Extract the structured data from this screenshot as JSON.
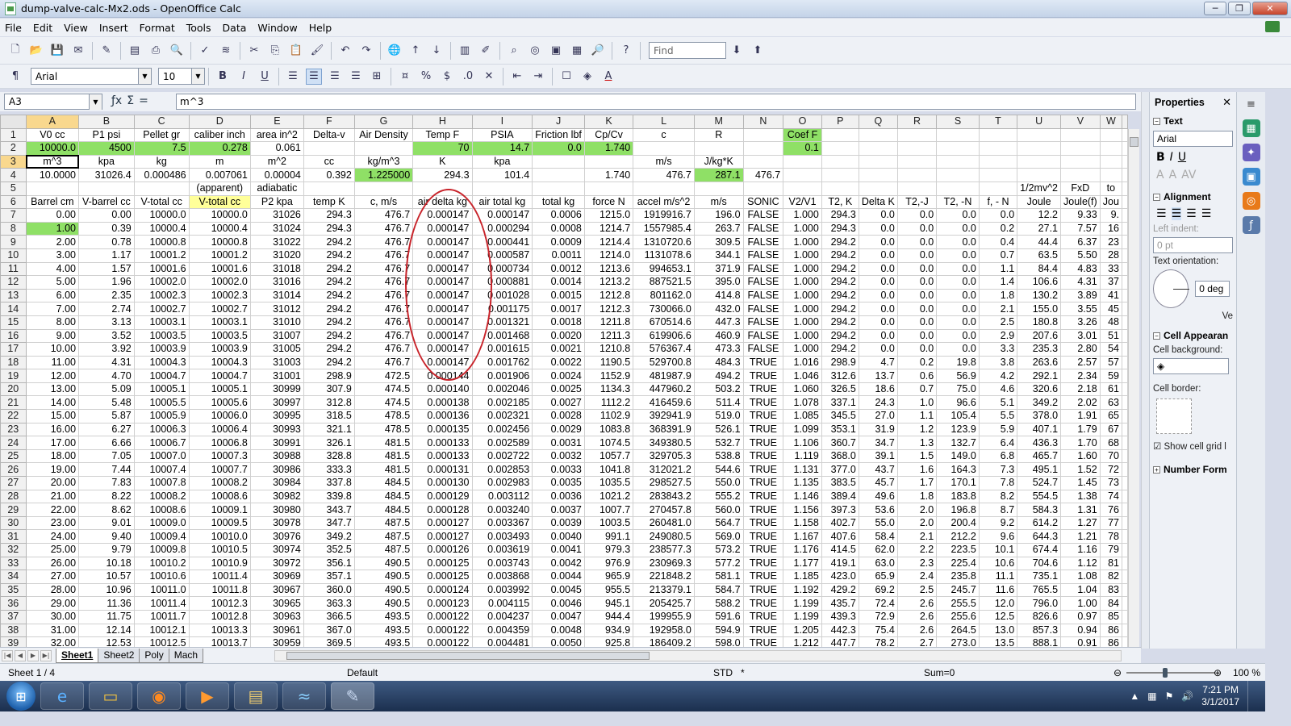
{
  "window": {
    "title": "dump-valve-calc-Mx2.ods - OpenOffice Calc",
    "minimize": "─",
    "maximize": "❐",
    "close": "✕"
  },
  "menu": [
    "File",
    "Edit",
    "View",
    "Insert",
    "Format",
    "Tools",
    "Data",
    "Window",
    "Help"
  ],
  "toolbar": {
    "find_placeholder": "Find",
    "font_name": "Arial",
    "font_size": "10"
  },
  "formula_bar": {
    "cell_ref": "A3",
    "content": "m^3",
    "fx": "ƒx",
    "sum": "Σ",
    "equals": "="
  },
  "sheet": {
    "columns": [
      "A",
      "B",
      "C",
      "D",
      "E",
      "F",
      "G",
      "H",
      "I",
      "J",
      "K",
      "L",
      "M",
      "N",
      "O",
      "P",
      "Q",
      "R",
      "S",
      "T",
      "U",
      "V",
      "W"
    ],
    "rows": [
      [
        "V0 cc",
        "P1 psi",
        "Pellet gr",
        "caliber inch",
        "area in^2",
        "Delta-v",
        "Air Density",
        "Temp F",
        "PSIA",
        "Friction lbf",
        "Cp/Cv",
        "c",
        "R",
        "",
        "Coef F",
        "",
        "",
        "",
        "",
        "",
        "",
        "",
        ""
      ],
      [
        "10000.0",
        "4500",
        "7.5",
        "0.278",
        "0.061",
        "",
        "",
        "70",
        "14.7",
        "0.0",
        "1.740",
        "",
        "",
        "",
        "0.1",
        "",
        "",
        "",
        "",
        "",
        "",
        "",
        ""
      ],
      [
        "m^3",
        "kpa",
        "kg",
        "m",
        "m^2",
        "cc",
        "kg/m^3",
        "K",
        "kpa",
        "",
        "",
        "m/s",
        "J/kg*K",
        "",
        "",
        "",
        "",
        "",
        "",
        "",
        "",
        "",
        ""
      ],
      [
        "10.0000",
        "31026.4",
        "0.000486",
        "0.007061",
        "0.00004",
        "0.392",
        "1.225000",
        "294.3",
        "101.4",
        "",
        "1.740",
        "476.7",
        "287.1",
        "476.7",
        "",
        "",
        "",
        "",
        "",
        "",
        "",
        "",
        ""
      ],
      [
        "",
        "",
        "",
        "(apparent)",
        "adiabatic",
        "",
        "",
        "",
        "",
        "",
        "",
        "",
        "",
        "",
        "",
        "",
        "",
        "",
        "",
        "",
        "1/2mv^2",
        "FxD",
        "to"
      ],
      [
        "Barrel cm",
        "V-barrel cc",
        "V-total cc",
        "V-total cc",
        "P2 kpa",
        "temp K",
        "c, m/s",
        "air delta kg",
        "air total kg",
        "total kg",
        "force N",
        "accel m/s^2",
        "m/s",
        "SONIC",
        "V2/V1",
        "T2, K",
        "Delta K",
        "T2,-J",
        "T2, -N",
        "f, - N",
        "Joule",
        "Joule(f)",
        "Jou"
      ],
      [
        "0.00",
        "0.00",
        "10000.0",
        "10000.0",
        "31026",
        "294.3",
        "476.7",
        "0.000147",
        "0.000147",
        "0.0006",
        "1215.0",
        "1919916.7",
        "196.0",
        "FALSE",
        "1.000",
        "294.3",
        "0.0",
        "0.0",
        "0.0",
        "0.0",
        "12.2",
        "9.33",
        "9."
      ],
      [
        "1.00",
        "0.39",
        "10000.4",
        "10000.4",
        "31024",
        "294.3",
        "476.7",
        "0.000147",
        "0.000294",
        "0.0008",
        "1214.7",
        "1557985.4",
        "263.7",
        "FALSE",
        "1.000",
        "294.3",
        "0.0",
        "0.0",
        "0.0",
        "0.2",
        "27.1",
        "7.57",
        "16"
      ],
      [
        "2.00",
        "0.78",
        "10000.8",
        "10000.8",
        "31022",
        "294.2",
        "476.7",
        "0.000147",
        "0.000441",
        "0.0009",
        "1214.4",
        "1310720.6",
        "309.5",
        "FALSE",
        "1.000",
        "294.2",
        "0.0",
        "0.0",
        "0.0",
        "0.4",
        "44.4",
        "6.37",
        "23"
      ],
      [
        "3.00",
        "1.17",
        "10001.2",
        "10001.2",
        "31020",
        "294.2",
        "476.7",
        "0.000147",
        "0.000587",
        "0.0011",
        "1214.0",
        "1131078.6",
        "344.1",
        "FALSE",
        "1.000",
        "294.2",
        "0.0",
        "0.0",
        "0.0",
        "0.7",
        "63.5",
        "5.50",
        "28"
      ],
      [
        "4.00",
        "1.57",
        "10001.6",
        "10001.6",
        "31018",
        "294.2",
        "476.7",
        "0.000147",
        "0.000734",
        "0.0012",
        "1213.6",
        "994653.1",
        "371.9",
        "FALSE",
        "1.000",
        "294.2",
        "0.0",
        "0.0",
        "0.0",
        "1.1",
        "84.4",
        "4.83",
        "33"
      ],
      [
        "5.00",
        "1.96",
        "10002.0",
        "10002.0",
        "31016",
        "294.2",
        "476.7",
        "0.000147",
        "0.000881",
        "0.0014",
        "1213.2",
        "887521.5",
        "395.0",
        "FALSE",
        "1.000",
        "294.2",
        "0.0",
        "0.0",
        "0.0",
        "1.4",
        "106.6",
        "4.31",
        "37"
      ],
      [
        "6.00",
        "2.35",
        "10002.3",
        "10002.3",
        "31014",
        "294.2",
        "476.7",
        "0.000147",
        "0.001028",
        "0.0015",
        "1212.8",
        "801162.0",
        "414.8",
        "FALSE",
        "1.000",
        "294.2",
        "0.0",
        "0.0",
        "0.0",
        "1.8",
        "130.2",
        "3.89",
        "41"
      ],
      [
        "7.00",
        "2.74",
        "10002.7",
        "10002.7",
        "31012",
        "294.2",
        "476.7",
        "0.000147",
        "0.001175",
        "0.0017",
        "1212.3",
        "730066.0",
        "432.0",
        "FALSE",
        "1.000",
        "294.2",
        "0.0",
        "0.0",
        "0.0",
        "2.1",
        "155.0",
        "3.55",
        "45"
      ],
      [
        "8.00",
        "3.13",
        "10003.1",
        "10003.1",
        "31010",
        "294.2",
        "476.7",
        "0.000147",
        "0.001321",
        "0.0018",
        "1211.8",
        "670514.6",
        "447.3",
        "FALSE",
        "1.000",
        "294.2",
        "0.0",
        "0.0",
        "0.0",
        "2.5",
        "180.8",
        "3.26",
        "48"
      ],
      [
        "9.00",
        "3.52",
        "10003.5",
        "10003.5",
        "31007",
        "294.2",
        "476.7",
        "0.000147",
        "0.001468",
        "0.0020",
        "1211.3",
        "619906.6",
        "460.9",
        "FALSE",
        "1.000",
        "294.2",
        "0.0",
        "0.0",
        "0.0",
        "2.9",
        "207.6",
        "3.01",
        "51"
      ],
      [
        "10.00",
        "3.92",
        "10003.9",
        "10003.9",
        "31005",
        "294.2",
        "476.7",
        "0.000147",
        "0.001615",
        "0.0021",
        "1210.8",
        "576367.4",
        "473.3",
        "FALSE",
        "1.000",
        "294.2",
        "0.0",
        "0.0",
        "0.0",
        "3.3",
        "235.3",
        "2.80",
        "54"
      ],
      [
        "11.00",
        "4.31",
        "10004.3",
        "10004.3",
        "31003",
        "294.2",
        "476.7",
        "0.000147",
        "0.001762",
        "0.0022",
        "1190.5",
        "529700.8",
        "484.3",
        "TRUE",
        "1.016",
        "298.9",
        "4.7",
        "0.2",
        "19.8",
        "3.8",
        "263.6",
        "2.57",
        "57"
      ],
      [
        "12.00",
        "4.70",
        "10004.7",
        "10004.7",
        "31001",
        "298.9",
        "472.5",
        "0.000144",
        "0.001906",
        "0.0024",
        "1152.9",
        "481987.9",
        "494.2",
        "TRUE",
        "1.046",
        "312.6",
        "13.7",
        "0.6",
        "56.9",
        "4.2",
        "292.1",
        "2.34",
        "59"
      ],
      [
        "13.00",
        "5.09",
        "10005.1",
        "10005.1",
        "30999",
        "307.9",
        "474.5",
        "0.000140",
        "0.002046",
        "0.0025",
        "1134.3",
        "447960.2",
        "503.2",
        "TRUE",
        "1.060",
        "326.5",
        "18.6",
        "0.7",
        "75.0",
        "4.6",
        "320.6",
        "2.18",
        "61"
      ],
      [
        "14.00",
        "5.48",
        "10005.5",
        "10005.6",
        "30997",
        "312.8",
        "474.5",
        "0.000138",
        "0.002185",
        "0.0027",
        "1112.2",
        "416459.6",
        "511.4",
        "TRUE",
        "1.078",
        "337.1",
        "24.3",
        "1.0",
        "96.6",
        "5.1",
        "349.2",
        "2.02",
        "63"
      ],
      [
        "15.00",
        "5.87",
        "10005.9",
        "10006.0",
        "30995",
        "318.5",
        "478.5",
        "0.000136",
        "0.002321",
        "0.0028",
        "1102.9",
        "392941.9",
        "519.0",
        "TRUE",
        "1.085",
        "345.5",
        "27.0",
        "1.1",
        "105.4",
        "5.5",
        "378.0",
        "1.91",
        "65"
      ],
      [
        "16.00",
        "6.27",
        "10006.3",
        "10006.4",
        "30993",
        "321.1",
        "478.5",
        "0.000135",
        "0.002456",
        "0.0029",
        "1083.8",
        "368391.9",
        "526.1",
        "TRUE",
        "1.099",
        "353.1",
        "31.9",
        "1.2",
        "123.9",
        "5.9",
        "407.1",
        "1.79",
        "67"
      ],
      [
        "17.00",
        "6.66",
        "10006.7",
        "10006.8",
        "30991",
        "326.1",
        "481.5",
        "0.000133",
        "0.002589",
        "0.0031",
        "1074.5",
        "349380.5",
        "532.7",
        "TRUE",
        "1.106",
        "360.7",
        "34.7",
        "1.3",
        "132.7",
        "6.4",
        "436.3",
        "1.70",
        "68"
      ],
      [
        "18.00",
        "7.05",
        "10007.0",
        "10007.3",
        "30988",
        "328.8",
        "481.5",
        "0.000133",
        "0.002722",
        "0.0032",
        "1057.7",
        "329705.3",
        "538.8",
        "TRUE",
        "1.119",
        "368.0",
        "39.1",
        "1.5",
        "149.0",
        "6.8",
        "465.7",
        "1.60",
        "70"
      ],
      [
        "19.00",
        "7.44",
        "10007.4",
        "10007.7",
        "30986",
        "333.3",
        "481.5",
        "0.000131",
        "0.002853",
        "0.0033",
        "1041.8",
        "312021.2",
        "544.6",
        "TRUE",
        "1.131",
        "377.0",
        "43.7",
        "1.6",
        "164.3",
        "7.3",
        "495.1",
        "1.52",
        "72"
      ],
      [
        "20.00",
        "7.83",
        "10007.8",
        "10008.2",
        "30984",
        "337.8",
        "484.5",
        "0.000130",
        "0.002983",
        "0.0035",
        "1035.5",
        "298527.5",
        "550.0",
        "TRUE",
        "1.135",
        "383.5",
        "45.7",
        "1.7",
        "170.1",
        "7.8",
        "524.7",
        "1.45",
        "73"
      ],
      [
        "21.00",
        "8.22",
        "10008.2",
        "10008.6",
        "30982",
        "339.8",
        "484.5",
        "0.000129",
        "0.003112",
        "0.0036",
        "1021.2",
        "283843.2",
        "555.2",
        "TRUE",
        "1.146",
        "389.4",
        "49.6",
        "1.8",
        "183.8",
        "8.2",
        "554.5",
        "1.38",
        "74"
      ],
      [
        "22.00",
        "8.62",
        "10008.6",
        "10009.1",
        "30980",
        "343.7",
        "484.5",
        "0.000128",
        "0.003240",
        "0.0037",
        "1007.7",
        "270457.8",
        "560.0",
        "TRUE",
        "1.156",
        "397.3",
        "53.6",
        "2.0",
        "196.8",
        "8.7",
        "584.3",
        "1.31",
        "76"
      ],
      [
        "23.00",
        "9.01",
        "10009.0",
        "10009.5",
        "30978",
        "347.7",
        "487.5",
        "0.000127",
        "0.003367",
        "0.0039",
        "1003.5",
        "260481.0",
        "564.7",
        "TRUE",
        "1.158",
        "402.7",
        "55.0",
        "2.0",
        "200.4",
        "9.2",
        "614.2",
        "1.27",
        "77"
      ],
      [
        "24.00",
        "9.40",
        "10009.4",
        "10010.0",
        "30976",
        "349.2",
        "487.5",
        "0.000127",
        "0.003493",
        "0.0040",
        "991.1",
        "249080.5",
        "569.0",
        "TRUE",
        "1.167",
        "407.6",
        "58.4",
        "2.1",
        "212.2",
        "9.6",
        "644.3",
        "1.21",
        "78"
      ],
      [
        "25.00",
        "9.79",
        "10009.8",
        "10010.5",
        "30974",
        "352.5",
        "487.5",
        "0.000126",
        "0.003619",
        "0.0041",
        "979.3",
        "238577.3",
        "573.2",
        "TRUE",
        "1.176",
        "414.5",
        "62.0",
        "2.2",
        "223.5",
        "10.1",
        "674.4",
        "1.16",
        "79"
      ],
      [
        "26.00",
        "10.18",
        "10010.2",
        "10010.9",
        "30972",
        "356.1",
        "490.5",
        "0.000125",
        "0.003743",
        "0.0042",
        "976.9",
        "230969.3",
        "577.2",
        "TRUE",
        "1.177",
        "419.1",
        "63.0",
        "2.3",
        "225.4",
        "10.6",
        "704.6",
        "1.12",
        "81"
      ],
      [
        "27.00",
        "10.57",
        "10010.6",
        "10011.4",
        "30969",
        "357.1",
        "490.5",
        "0.000125",
        "0.003868",
        "0.0044",
        "965.9",
        "221848.2",
        "581.1",
        "TRUE",
        "1.185",
        "423.0",
        "65.9",
        "2.4",
        "235.8",
        "11.1",
        "735.1",
        "1.08",
        "82"
      ],
      [
        "28.00",
        "10.96",
        "10011.0",
        "10011.8",
        "30967",
        "360.0",
        "490.5",
        "0.000124",
        "0.003992",
        "0.0045",
        "955.5",
        "213379.1",
        "584.7",
        "TRUE",
        "1.192",
        "429.2",
        "69.2",
        "2.5",
        "245.7",
        "11.6",
        "765.5",
        "1.04",
        "83"
      ],
      [
        "29.00",
        "11.36",
        "10011.4",
        "10012.3",
        "30965",
        "363.3",
        "490.5",
        "0.000123",
        "0.004115",
        "0.0046",
        "945.1",
        "205425.7",
        "588.2",
        "TRUE",
        "1.199",
        "435.7",
        "72.4",
        "2.6",
        "255.5",
        "12.0",
        "796.0",
        "1.00",
        "84"
      ],
      [
        "30.00",
        "11.75",
        "10011.7",
        "10012.8",
        "30963",
        "366.5",
        "493.5",
        "0.000122",
        "0.004237",
        "0.0047",
        "944.4",
        "199955.9",
        "591.6",
        "TRUE",
        "1.199",
        "439.3",
        "72.9",
        "2.6",
        "255.6",
        "12.5",
        "826.6",
        "0.97",
        "85"
      ],
      [
        "31.00",
        "12.14",
        "10012.1",
        "10013.3",
        "30961",
        "367.0",
        "493.5",
        "0.000122",
        "0.004359",
        "0.0048",
        "934.9",
        "192958.0",
        "594.9",
        "TRUE",
        "1.205",
        "442.3",
        "75.4",
        "2.6",
        "264.5",
        "13.0",
        "857.3",
        "0.94",
        "86"
      ],
      [
        "32.00",
        "12.53",
        "10012.5",
        "10013.7",
        "30959",
        "369.5",
        "493.5",
        "0.000122",
        "0.004481",
        "0.0050",
        "925.8",
        "186409.2",
        "598.0",
        "TRUE",
        "1.212",
        "447.7",
        "78.2",
        "2.7",
        "273.0",
        "13.5",
        "888.1",
        "0.91",
        "86"
      ]
    ]
  },
  "sheet_tabs": [
    "Sheet1",
    "Sheet2",
    "Poly",
    "Mach"
  ],
  "status": {
    "sheet": "Sheet 1 / 4",
    "style": "Default",
    "mode": "STD",
    "modified": "*",
    "sum": "Sum=0",
    "zoom": "100 %"
  },
  "properties": {
    "title": "Properties",
    "text_section": "Text",
    "font": "Arial",
    "alignment_section": "Alignment",
    "left_indent_label": "Left indent:",
    "left_indent_value": "0 pt",
    "orientation_label": "Text orientation:",
    "orientation_value": "0 deg",
    "vertical_stack": "Ve",
    "cell_appearance_section": "Cell Appearan",
    "cell_background_label": "Cell background:",
    "cell_border_label": "Cell border:",
    "show_grid_label": "Show cell grid l",
    "number_format_section": "Number Form"
  },
  "taskbar": {
    "time": "7:21 PM",
    "date": "3/1/2017"
  },
  "colors": {
    "green_cell": "#8fe066",
    "yellow_cell": "#ffff99",
    "annotation_ellipse": "#c8232a"
  }
}
